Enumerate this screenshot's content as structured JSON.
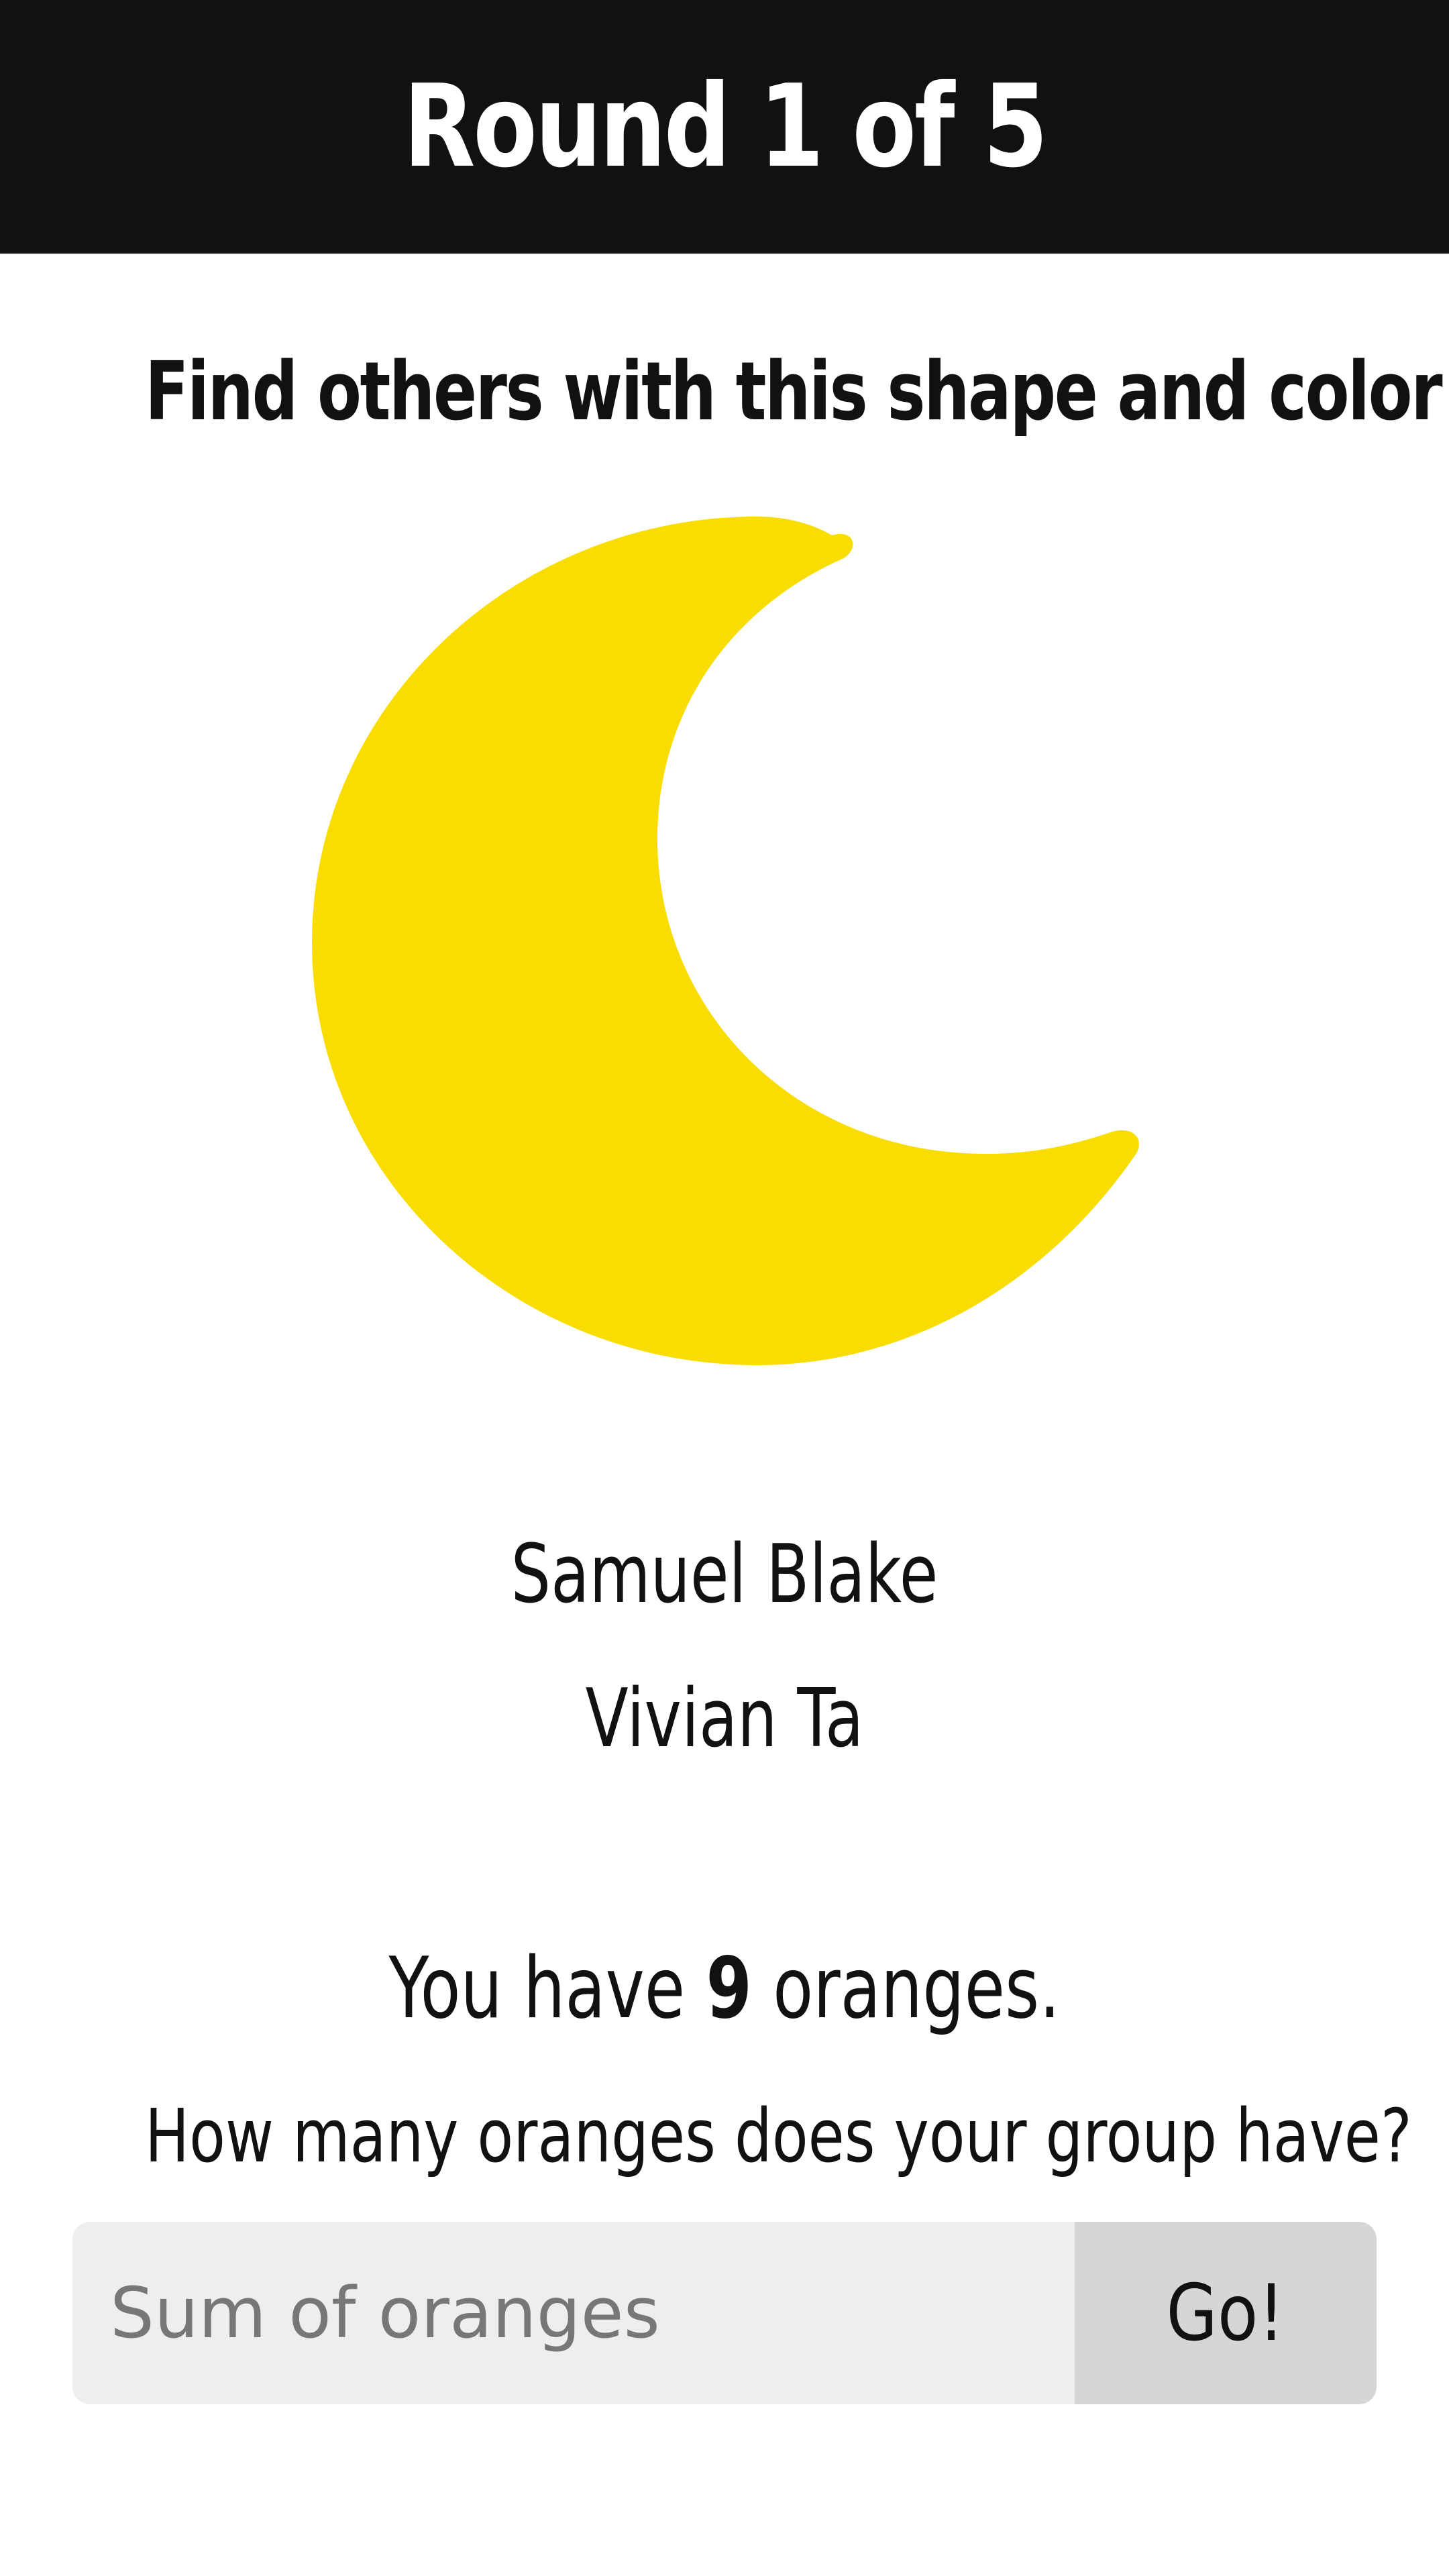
{
  "header": {
    "title": "Round 1 of 5"
  },
  "prompt": "Find others with this shape and color",
  "shape": {
    "icon": "crescent-moon",
    "color": "#F9DC00"
  },
  "group": {
    "names": [
      "Samuel Blake",
      "Vivian Ta"
    ]
  },
  "status": {
    "prefix": "You have ",
    "count": "9",
    "suffix": " oranges."
  },
  "question": "How many oranges does your group have?",
  "form": {
    "placeholder": "Sum of oranges",
    "button_label": "Go!"
  },
  "colors": {
    "header_bg": "#111111",
    "input_bg": "#EEEEEE",
    "button_bg": "#D6D6D6"
  }
}
